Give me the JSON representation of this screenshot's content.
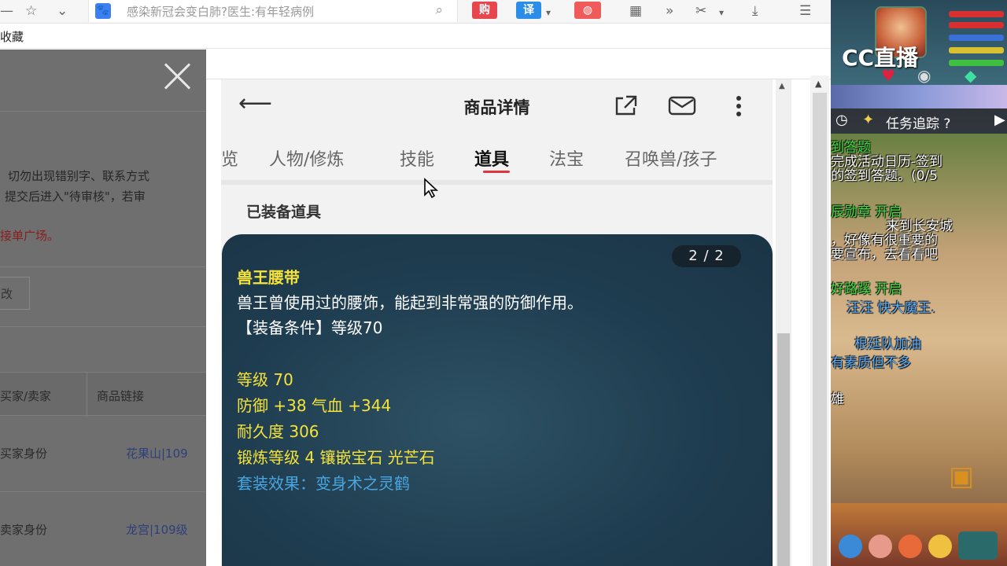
{
  "browser": {
    "page_title": "感染新冠会变白肺?医生:有年轻病例",
    "bookmark_label": "收藏",
    "ext_buy": "购",
    "ext_translate": "译"
  },
  "left_page": {
    "line1": "切勿出现错别字、联系方式",
    "line2": "提交后进入\"待审核\"，若审",
    "red_line": "接单广场。",
    "box_label": "改",
    "col1": "买家/卖家",
    "col2": "商品链接",
    "row1_role": "买家身份",
    "row1_link": "花果山|109",
    "row2_role": "卖家身份",
    "row2_link": "龙宫|109级"
  },
  "phone": {
    "header_title": "商品详情",
    "tabs": [
      {
        "label": "览"
      },
      {
        "label": "人物/修炼"
      },
      {
        "label": "技能"
      },
      {
        "label": "道具"
      },
      {
        "label": "法宝"
      },
      {
        "label": "召唤兽/孩子"
      }
    ],
    "section_title": "已装备道具",
    "card": {
      "page_indicator": "2 / 2",
      "item_name": "兽王腰带",
      "description": "兽王曾使用过的腰饰，能起到非常强的防御作用。",
      "requirement": "【装备条件】等级70",
      "stat_level": "等级 70",
      "stat_defense": "防御 +38 气血 +344",
      "stat_durability": "耐久度 306",
      "stat_forge": "锻炼等级 4 镶嵌宝石 光芒石",
      "set_effect": "套装效果：变身术之灵鹤"
    }
  },
  "game_stream": {
    "logo": "CC直播",
    "quest_label": "任务追踪 ?",
    "chat": [
      {
        "text": "到答题"
      },
      {
        "text": "完成活动日历-签到"
      },
      {
        "text": "的签到答题。(0/5"
      },
      {
        "text": "辰勋章 开启"
      },
      {
        "text": "来到长安城"
      },
      {
        "text": "，好像有很重要的"
      },
      {
        "text": "要宣布，去看看吧"
      },
      {
        "text": "好路蹊 开启"
      },
      {
        "text": "汪汪 快大魔王."
      },
      {
        "text": "根廷队加油"
      },
      {
        "text": "有素质但不多"
      },
      {
        "text": "雄"
      }
    ]
  }
}
